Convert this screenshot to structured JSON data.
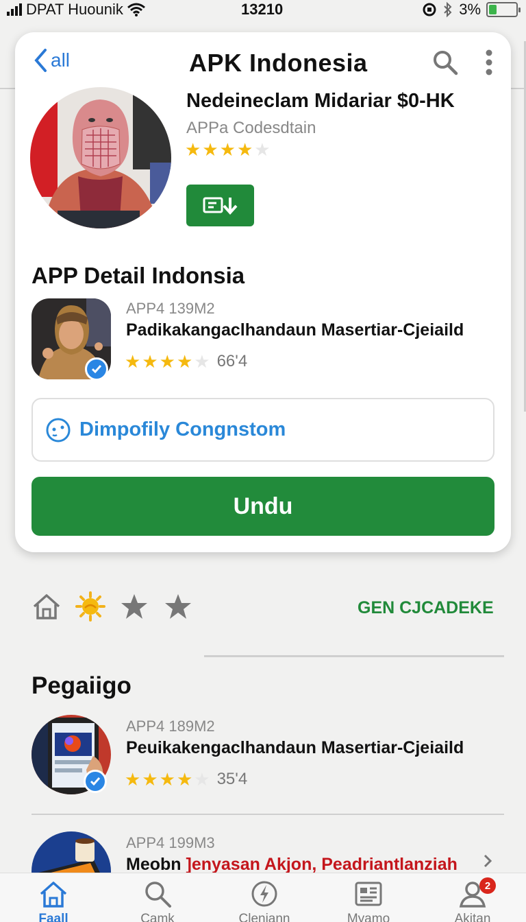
{
  "status_bar": {
    "carrier": "DPAT Huounik",
    "time": "13210",
    "battery": "3%",
    "battery_level": 0.3
  },
  "header": {
    "back_label": "all",
    "title": "APK Indonesia"
  },
  "hero": {
    "app_name": "Nedeineclam Midariar $0-HK",
    "developer": "APPa Codesdtain",
    "rating_stars": 3.5
  },
  "detail": {
    "section_title": "APP Detail Indonsia",
    "meta": "APP4 139M2",
    "description": "Padikakangaclhandaun Masertiar-Cjeiaild",
    "rating_stars": 4,
    "rating_value": "66'4"
  },
  "developer_box": {
    "label": "Dimpofily Congnstom"
  },
  "download_button": {
    "label": "Undu"
  },
  "actions": {
    "link_label": "GEN CJCADEKE"
  },
  "list": {
    "heading": "Pegaiigo",
    "items": [
      {
        "meta": "APP4 189M2",
        "description": "Peuikakengaclhandaun Masertiar-Cjeiaild",
        "rating_stars": 4,
        "rating_value": "35'4"
      },
      {
        "meta": "APP4 199M3",
        "description_plain": "Meobn ",
        "description_red": "]enyasan Akjon, Peadriantlanziah"
      }
    ]
  },
  "tab_bar": {
    "tabs": [
      {
        "label": "Faall",
        "icon": "home-icon"
      },
      {
        "label": "Camk",
        "icon": "search-icon"
      },
      {
        "label": "Clenjann",
        "icon": "lightning-icon"
      },
      {
        "label": "Myamo",
        "icon": "news-icon"
      },
      {
        "label": "Akitan",
        "icon": "profile-icon",
        "badge": "2"
      }
    ]
  },
  "colors": {
    "accent_green": "#228b3b",
    "accent_blue": "#2a79d6",
    "star_gold": "#f5b90f",
    "badge_red": "#d9261c"
  }
}
